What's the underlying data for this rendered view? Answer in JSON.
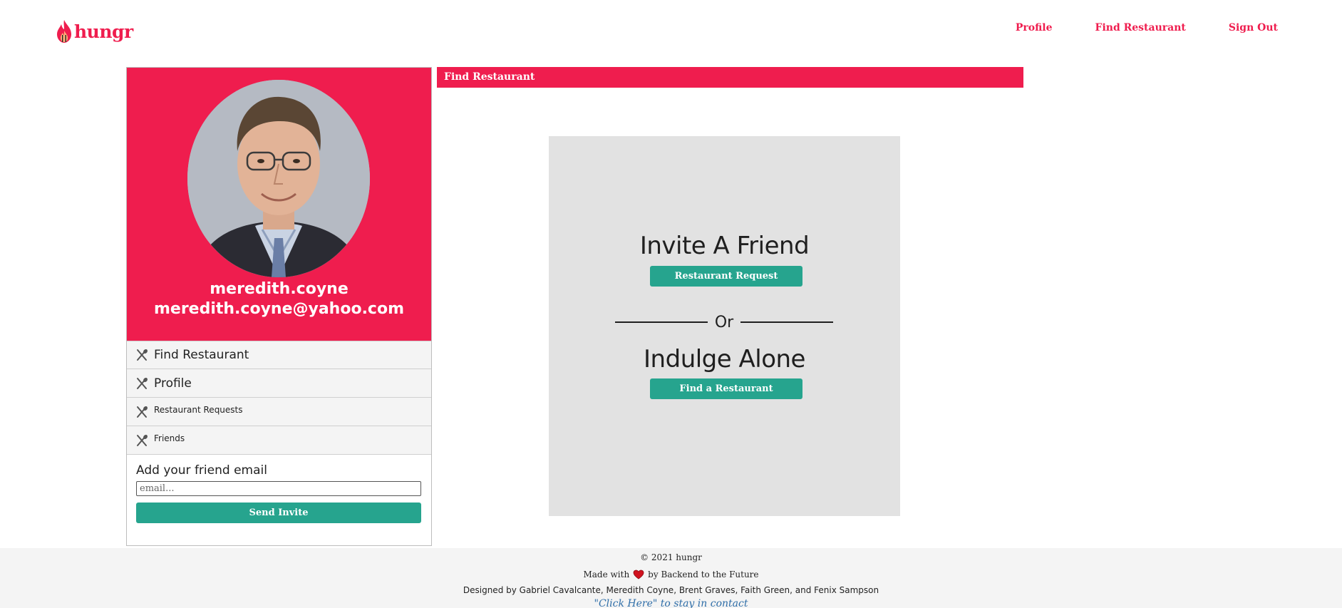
{
  "app": {
    "logo_text": "hungr",
    "brand_color": "#ef1d4e",
    "accent_color": "#26a48e"
  },
  "nav": {
    "items": [
      {
        "label": "Profile"
      },
      {
        "label": "Find Restaurant"
      },
      {
        "label": "Sign Out"
      }
    ]
  },
  "sidebar": {
    "username": "meredith.coyne",
    "email": "meredith.coyne@yahoo.com",
    "menu": [
      {
        "label": "Find Restaurant",
        "icon": "utensils-icon"
      },
      {
        "label": "Profile",
        "icon": "utensils-icon"
      },
      {
        "label": "Restaurant Requests",
        "icon": "utensils-icon"
      },
      {
        "label": "Friends",
        "icon": "utensils-icon"
      }
    ],
    "invite": {
      "title": "Add your friend email",
      "placeholder": "email...",
      "value": "",
      "button_label": "Send Invite"
    }
  },
  "main": {
    "section_title": "Find Restaurant",
    "panel": {
      "invite_heading": "Invite A Friend",
      "request_button": "Restaurant Request",
      "or_text": "Or",
      "indulge_heading": "Indulge Alone",
      "find_button": "Find a Restaurant"
    }
  },
  "footer": {
    "copyright": "© 2021 hungr",
    "made_prefix": "Made with",
    "made_suffix": "by Backend to the Future",
    "designed_by": "Designed by Gabriel Cavalcante, Meredith Coyne, Brent Graves, Faith Green, and Fenix Sampson",
    "contact_link": "\"Click Here\" to stay in contact"
  }
}
